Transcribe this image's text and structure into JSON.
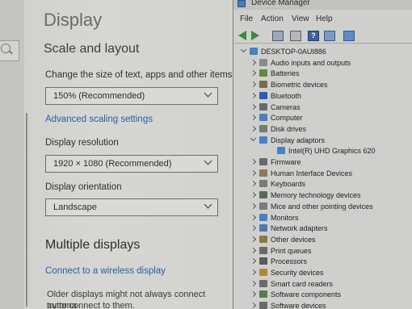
{
  "settings": {
    "title": "Display",
    "scale_heading": "Scale and layout",
    "scale_label": "Change the size of text, apps and other items",
    "scale_value": "150% (Recommended)",
    "advanced_link": "Advanced scaling settings",
    "resolution_label": "Display resolution",
    "resolution_value": "1920 × 1080 (Recommended)",
    "orientation_label": "Display orientation",
    "orientation_value": "Landscape",
    "multi_heading": "Multiple displays",
    "wireless_link": "Connect to a wireless display",
    "note_line1": "Older displays might not always connect automa",
    "note_line2": "try to connect to them."
  },
  "device_manager": {
    "title": "Device Manager",
    "menu": [
      "File",
      "Action",
      "View",
      "Help"
    ],
    "root": "DESKTOP-0AUI886",
    "items": [
      {
        "label": "Audio inputs and outputs",
        "icon": "speaker-icon",
        "color": "#8a8a8a"
      },
      {
        "label": "Batteries",
        "icon": "battery-icon",
        "color": "#5c8a3c"
      },
      {
        "label": "Biometric devices",
        "icon": "fingerprint-icon",
        "color": "#7a6a5a"
      },
      {
        "label": "Bluetooth",
        "icon": "bluetooth-icon",
        "color": "#2a5fb0"
      },
      {
        "label": "Cameras",
        "icon": "camera-icon",
        "color": "#6a6a6a"
      },
      {
        "label": "Computer",
        "icon": "computer-icon",
        "color": "#4a7fc0"
      },
      {
        "label": "Disk drives",
        "icon": "disk-icon",
        "color": "#7a7a7a"
      },
      {
        "label": "Display adaptors",
        "icon": "display-adapter-icon",
        "color": "#4a80c2",
        "expanded": true
      },
      {
        "label": "Intel(R) UHD Graphics 620",
        "icon": "monitor-icon",
        "color": "#4a80c2",
        "child": true
      },
      {
        "label": "Firmware",
        "icon": "firmware-icon",
        "color": "#6a6a6a"
      },
      {
        "label": "Human Interface Devices",
        "icon": "hid-icon",
        "color": "#8a7a5a"
      },
      {
        "label": "Keyboards",
        "icon": "keyboard-icon",
        "color": "#7a7a7a"
      },
      {
        "label": "Memory technology devices",
        "icon": "memory-icon",
        "color": "#5a6a5a"
      },
      {
        "label": "Mice and other pointing devices",
        "icon": "mouse-icon",
        "color": "#7a7a7a"
      },
      {
        "label": "Monitors",
        "icon": "monitor-icon",
        "color": "#4a80c2"
      },
      {
        "label": "Network adapters",
        "icon": "network-icon",
        "color": "#4a7ab0"
      },
      {
        "label": "Other devices",
        "icon": "other-devices-icon",
        "color": "#8a7a4a"
      },
      {
        "label": "Print queues",
        "icon": "printer-icon",
        "color": "#6a6a6a"
      },
      {
        "label": "Processors",
        "icon": "processor-icon",
        "color": "#5a5a5a"
      },
      {
        "label": "Security devices",
        "icon": "security-icon",
        "color": "#b08a3a"
      },
      {
        "label": "Smart card readers",
        "icon": "smartcard-icon",
        "color": "#6a6a6a"
      },
      {
        "label": "Software components",
        "icon": "software-icon",
        "color": "#5a7a5a"
      },
      {
        "label": "Software devices",
        "icon": "software-device-icon",
        "color": "#6a6a6a"
      }
    ]
  }
}
